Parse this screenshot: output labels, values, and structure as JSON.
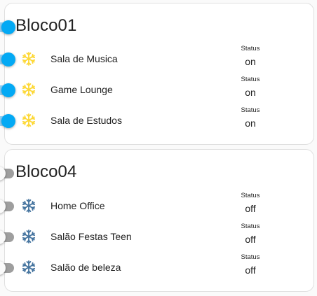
{
  "colors": {
    "accent": "#03a9f4",
    "icon_on": "#fdd835",
    "icon_off": "#44739e"
  },
  "groups": [
    {
      "title": "Bloco01",
      "state": "on",
      "items": [
        {
          "label": "Sala de Musica",
          "status_caption": "Status",
          "status_value": "on",
          "icon": "snowflake-icon",
          "state": "on"
        },
        {
          "label": "Game Lounge",
          "status_caption": "Status",
          "status_value": "on",
          "icon": "snowflake-icon",
          "state": "on"
        },
        {
          "label": "Sala de Estudos",
          "status_caption": "Status",
          "status_value": "on",
          "icon": "snowflake-icon",
          "state": "on"
        }
      ]
    },
    {
      "title": "Bloco04",
      "state": "off",
      "items": [
        {
          "label": "Home Office",
          "status_caption": "Status",
          "status_value": "off",
          "icon": "snowflake-icon",
          "state": "off"
        },
        {
          "label": "Salão Festas Teen",
          "status_caption": "Status",
          "status_value": "off",
          "icon": "snowflake-icon",
          "state": "off"
        },
        {
          "label": "Salão de beleza",
          "status_caption": "Status",
          "status_value": "off",
          "icon": "snowflake-icon",
          "state": "off"
        }
      ]
    }
  ]
}
